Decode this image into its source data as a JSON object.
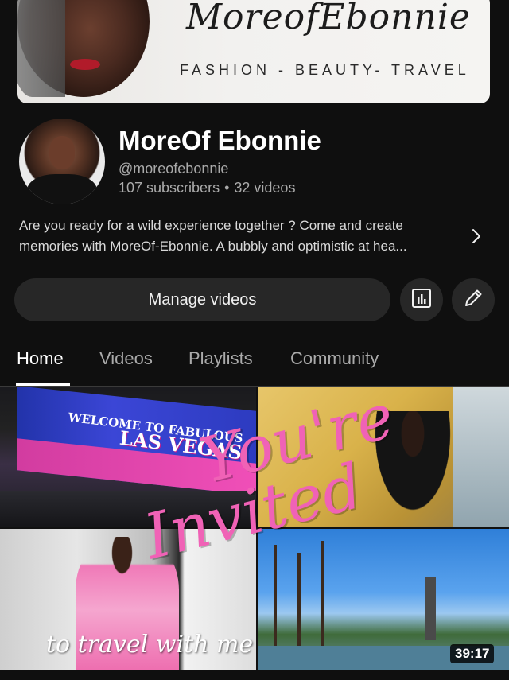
{
  "banner": {
    "script_text": "MoreofEbonnie",
    "tagline": "FASHION - BEAUTY- TRAVEL"
  },
  "channel": {
    "name": "MoreOf Ebonnie",
    "handle": "@moreofebonnie",
    "subscribers": "107 subscribers",
    "separator": "•",
    "videos": "32 videos",
    "description_line1": "Are you ready for a wild experience together ? Come and create",
    "description_line2": "memories with MoreOf-Ebonnie. A bubbly and optimistic at hea..."
  },
  "actions": {
    "manage_videos_label": "Manage videos",
    "analytics_icon": "bar-chart-icon",
    "edit_icon": "pencil-icon"
  },
  "tabs": [
    {
      "label": "Home",
      "active": true
    },
    {
      "label": "Videos",
      "active": false
    },
    {
      "label": "Playlists",
      "active": false
    },
    {
      "label": "Community",
      "active": false
    }
  ],
  "featured_video": {
    "overlay_line1": "You're",
    "overlay_line2": "Invited",
    "overlay_caption": "to travel with me",
    "sign_small": "WELCOME TO FABULOUS",
    "sign_large": "LAS VEGAS",
    "duration": "39:17"
  },
  "colors": {
    "background": "#0f0f0f",
    "button_bg": "#272727",
    "secondary_text": "#aaaaaa",
    "accent_pink": "#f062b6"
  }
}
